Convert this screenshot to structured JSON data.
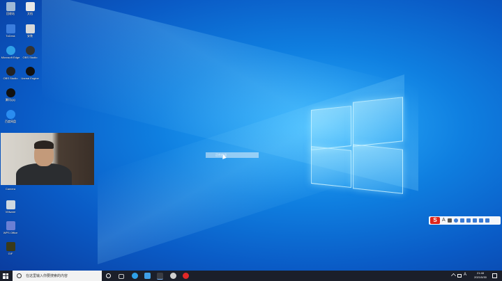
{
  "desktop": {
    "icons": [
      {
        "label": "回收站",
        "icon": "recycle-bin-icon",
        "color": "#9fb8d6"
      },
      {
        "label": "文档",
        "icon": "document-icon",
        "color": "#e8e8e8"
      },
      {
        "label": "ToDesk",
        "icon": "app-icon",
        "color": "#3b7ddd"
      },
      {
        "label": "安装",
        "icon": "installer-icon",
        "color": "#d8d8d8"
      },
      {
        "label": "Microsoft Edge",
        "icon": "edge-icon",
        "color": "#2fa0e8"
      },
      {
        "label": "OBS Studio",
        "icon": "obs-icon",
        "color": "#333333"
      },
      {
        "label": "OBS Studio",
        "icon": "obs-icon",
        "color": "#222222"
      },
      {
        "label": "Unreal Engine",
        "icon": "unreal-icon",
        "color": "#111111"
      },
      {
        "label": "腾讯QQ",
        "icon": "qq-icon",
        "color": "#111111"
      },
      {
        "label": "百度网盘",
        "icon": "cloud-icon",
        "color": "#2a8cf0"
      },
      {
        "label": "Camera",
        "icon": "camera-icon",
        "color": "#2a5fb0"
      },
      {
        "label": "VMware",
        "icon": "vmware-icon",
        "color": "#cfd8e0"
      },
      {
        "label": "WPS Office",
        "icon": "wps-icon",
        "color": "#6a7fd4"
      },
      {
        "label": "GIF",
        "icon": "gif-icon",
        "color": "#3a3a1a"
      }
    ]
  },
  "dialog": {
    "text": "正在启动"
  },
  "ime": {
    "logo": "S",
    "lang": "A"
  },
  "taskbar": {
    "search_placeholder": "在这里输入你要搜索的内容",
    "clock_time": "21:48",
    "clock_date": "2021/5/30",
    "tray_lang": "A",
    "pinned": [
      {
        "icon": "cortana-icon",
        "color": "#1b1f2a"
      },
      {
        "icon": "task-view-icon",
        "color": "#1b1f2a"
      },
      {
        "icon": "edge-icon",
        "color": "#2fa0e8"
      },
      {
        "icon": "explorer-icon",
        "color": "#3fa0e8"
      },
      {
        "icon": "obs-icon",
        "color": "#3a3d44"
      },
      {
        "icon": "app-icon",
        "color": "#d0d0d0"
      },
      {
        "icon": "netease-music-icon",
        "color": "#e02828"
      }
    ]
  }
}
